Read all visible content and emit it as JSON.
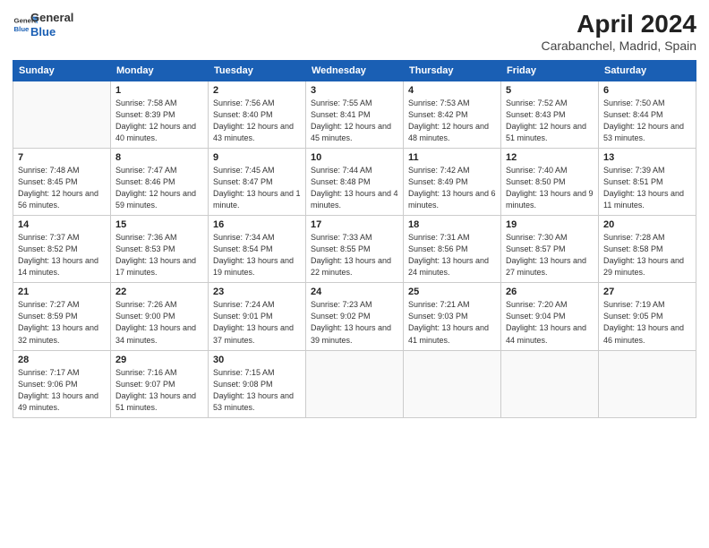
{
  "header": {
    "logo_line1": "General",
    "logo_line2": "Blue",
    "title": "April 2024",
    "subtitle": "Carabanchel, Madrid, Spain"
  },
  "calendar": {
    "columns": [
      "Sunday",
      "Monday",
      "Tuesday",
      "Wednesday",
      "Thursday",
      "Friday",
      "Saturday"
    ],
    "weeks": [
      [
        {
          "day": "",
          "sunrise": "",
          "sunset": "",
          "daylight": ""
        },
        {
          "day": "1",
          "sunrise": "Sunrise: 7:58 AM",
          "sunset": "Sunset: 8:39 PM",
          "daylight": "Daylight: 12 hours and 40 minutes."
        },
        {
          "day": "2",
          "sunrise": "Sunrise: 7:56 AM",
          "sunset": "Sunset: 8:40 PM",
          "daylight": "Daylight: 12 hours and 43 minutes."
        },
        {
          "day": "3",
          "sunrise": "Sunrise: 7:55 AM",
          "sunset": "Sunset: 8:41 PM",
          "daylight": "Daylight: 12 hours and 45 minutes."
        },
        {
          "day": "4",
          "sunrise": "Sunrise: 7:53 AM",
          "sunset": "Sunset: 8:42 PM",
          "daylight": "Daylight: 12 hours and 48 minutes."
        },
        {
          "day": "5",
          "sunrise": "Sunrise: 7:52 AM",
          "sunset": "Sunset: 8:43 PM",
          "daylight": "Daylight: 12 hours and 51 minutes."
        },
        {
          "day": "6",
          "sunrise": "Sunrise: 7:50 AM",
          "sunset": "Sunset: 8:44 PM",
          "daylight": "Daylight: 12 hours and 53 minutes."
        }
      ],
      [
        {
          "day": "7",
          "sunrise": "Sunrise: 7:48 AM",
          "sunset": "Sunset: 8:45 PM",
          "daylight": "Daylight: 12 hours and 56 minutes."
        },
        {
          "day": "8",
          "sunrise": "Sunrise: 7:47 AM",
          "sunset": "Sunset: 8:46 PM",
          "daylight": "Daylight: 12 hours and 59 minutes."
        },
        {
          "day": "9",
          "sunrise": "Sunrise: 7:45 AM",
          "sunset": "Sunset: 8:47 PM",
          "daylight": "Daylight: 13 hours and 1 minute."
        },
        {
          "day": "10",
          "sunrise": "Sunrise: 7:44 AM",
          "sunset": "Sunset: 8:48 PM",
          "daylight": "Daylight: 13 hours and 4 minutes."
        },
        {
          "day": "11",
          "sunrise": "Sunrise: 7:42 AM",
          "sunset": "Sunset: 8:49 PM",
          "daylight": "Daylight: 13 hours and 6 minutes."
        },
        {
          "day": "12",
          "sunrise": "Sunrise: 7:40 AM",
          "sunset": "Sunset: 8:50 PM",
          "daylight": "Daylight: 13 hours and 9 minutes."
        },
        {
          "day": "13",
          "sunrise": "Sunrise: 7:39 AM",
          "sunset": "Sunset: 8:51 PM",
          "daylight": "Daylight: 13 hours and 11 minutes."
        }
      ],
      [
        {
          "day": "14",
          "sunrise": "Sunrise: 7:37 AM",
          "sunset": "Sunset: 8:52 PM",
          "daylight": "Daylight: 13 hours and 14 minutes."
        },
        {
          "day": "15",
          "sunrise": "Sunrise: 7:36 AM",
          "sunset": "Sunset: 8:53 PM",
          "daylight": "Daylight: 13 hours and 17 minutes."
        },
        {
          "day": "16",
          "sunrise": "Sunrise: 7:34 AM",
          "sunset": "Sunset: 8:54 PM",
          "daylight": "Daylight: 13 hours and 19 minutes."
        },
        {
          "day": "17",
          "sunrise": "Sunrise: 7:33 AM",
          "sunset": "Sunset: 8:55 PM",
          "daylight": "Daylight: 13 hours and 22 minutes."
        },
        {
          "day": "18",
          "sunrise": "Sunrise: 7:31 AM",
          "sunset": "Sunset: 8:56 PM",
          "daylight": "Daylight: 13 hours and 24 minutes."
        },
        {
          "day": "19",
          "sunrise": "Sunrise: 7:30 AM",
          "sunset": "Sunset: 8:57 PM",
          "daylight": "Daylight: 13 hours and 27 minutes."
        },
        {
          "day": "20",
          "sunrise": "Sunrise: 7:28 AM",
          "sunset": "Sunset: 8:58 PM",
          "daylight": "Daylight: 13 hours and 29 minutes."
        }
      ],
      [
        {
          "day": "21",
          "sunrise": "Sunrise: 7:27 AM",
          "sunset": "Sunset: 8:59 PM",
          "daylight": "Daylight: 13 hours and 32 minutes."
        },
        {
          "day": "22",
          "sunrise": "Sunrise: 7:26 AM",
          "sunset": "Sunset: 9:00 PM",
          "daylight": "Daylight: 13 hours and 34 minutes."
        },
        {
          "day": "23",
          "sunrise": "Sunrise: 7:24 AM",
          "sunset": "Sunset: 9:01 PM",
          "daylight": "Daylight: 13 hours and 37 minutes."
        },
        {
          "day": "24",
          "sunrise": "Sunrise: 7:23 AM",
          "sunset": "Sunset: 9:02 PM",
          "daylight": "Daylight: 13 hours and 39 minutes."
        },
        {
          "day": "25",
          "sunrise": "Sunrise: 7:21 AM",
          "sunset": "Sunset: 9:03 PM",
          "daylight": "Daylight: 13 hours and 41 minutes."
        },
        {
          "day": "26",
          "sunrise": "Sunrise: 7:20 AM",
          "sunset": "Sunset: 9:04 PM",
          "daylight": "Daylight: 13 hours and 44 minutes."
        },
        {
          "day": "27",
          "sunrise": "Sunrise: 7:19 AM",
          "sunset": "Sunset: 9:05 PM",
          "daylight": "Daylight: 13 hours and 46 minutes."
        }
      ],
      [
        {
          "day": "28",
          "sunrise": "Sunrise: 7:17 AM",
          "sunset": "Sunset: 9:06 PM",
          "daylight": "Daylight: 13 hours and 49 minutes."
        },
        {
          "day": "29",
          "sunrise": "Sunrise: 7:16 AM",
          "sunset": "Sunset: 9:07 PM",
          "daylight": "Daylight: 13 hours and 51 minutes."
        },
        {
          "day": "30",
          "sunrise": "Sunrise: 7:15 AM",
          "sunset": "Sunset: 9:08 PM",
          "daylight": "Daylight: 13 hours and 53 minutes."
        },
        {
          "day": "",
          "sunrise": "",
          "sunset": "",
          "daylight": ""
        },
        {
          "day": "",
          "sunrise": "",
          "sunset": "",
          "daylight": ""
        },
        {
          "day": "",
          "sunrise": "",
          "sunset": "",
          "daylight": ""
        },
        {
          "day": "",
          "sunrise": "",
          "sunset": "",
          "daylight": ""
        }
      ]
    ]
  }
}
